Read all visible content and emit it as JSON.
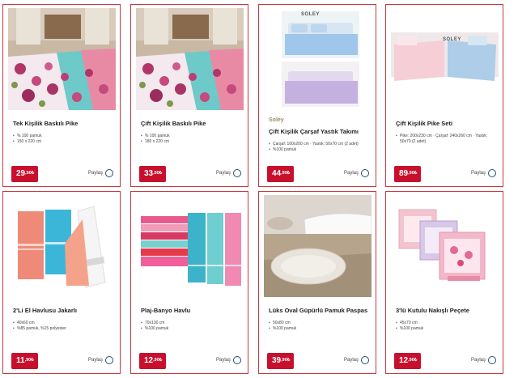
{
  "share_label": "Paylaş",
  "products": [
    {
      "title": "Tek Kişilik Baskılı Pike",
      "brand": "",
      "details": [
        "% 100 pamuk",
        "150 x 220 cm"
      ],
      "price_main": "29",
      "price_dec": ",90₺"
    },
    {
      "title": "Çift Kişilik Baskılı Pike",
      "brand": "",
      "details": [
        "% 100 pamuk",
        "180 x 220 cm"
      ],
      "price_main": "33",
      "price_dec": ",90₺"
    },
    {
      "title": "Çift Kişilik Çarşaf Yastık Takımı",
      "brand": "Soley",
      "image_logo": "SOLEY",
      "details": [
        "Çarşaf: 160x200 cm · Yastık: 50x70 cm (2 adet)",
        "%100 pamuk"
      ],
      "price_main": "44",
      "price_dec": ",90₺"
    },
    {
      "title": "Çift Kişilik Pike Seti",
      "brand": "",
      "image_logo": "SOLEY",
      "details": [
        "Pike: 200x230 cm · Çarşaf: 240x260 cm · Yastık: 50x70 (2 adet)"
      ],
      "price_main": "89",
      "price_dec": ",90₺"
    },
    {
      "title": "2'Li El Havlusu Jakarlı",
      "brand": "",
      "details": [
        "40x60 cm",
        "%85 pamuk, %15 polyester"
      ],
      "price_main": "11",
      "price_dec": ",90₺"
    },
    {
      "title": "Plaj-Banyo Havlu",
      "brand": "",
      "details": [
        "70x130 cm",
        "%100 pamuk"
      ],
      "price_main": "12",
      "price_dec": ",90₺"
    },
    {
      "title": "Lüks Oval Güpürlü Pamuk Paspas",
      "brand": "",
      "details": [
        "50x80 cm",
        "%100 pamuk"
      ],
      "price_main": "39",
      "price_dec": ",90₺"
    },
    {
      "title": "3'lü Kutulu Nakışlı Peçete",
      "brand": "",
      "details": [
        "45x70 cm",
        "%100 pamuk"
      ],
      "price_main": "12",
      "price_dec": ",90₺"
    }
  ]
}
